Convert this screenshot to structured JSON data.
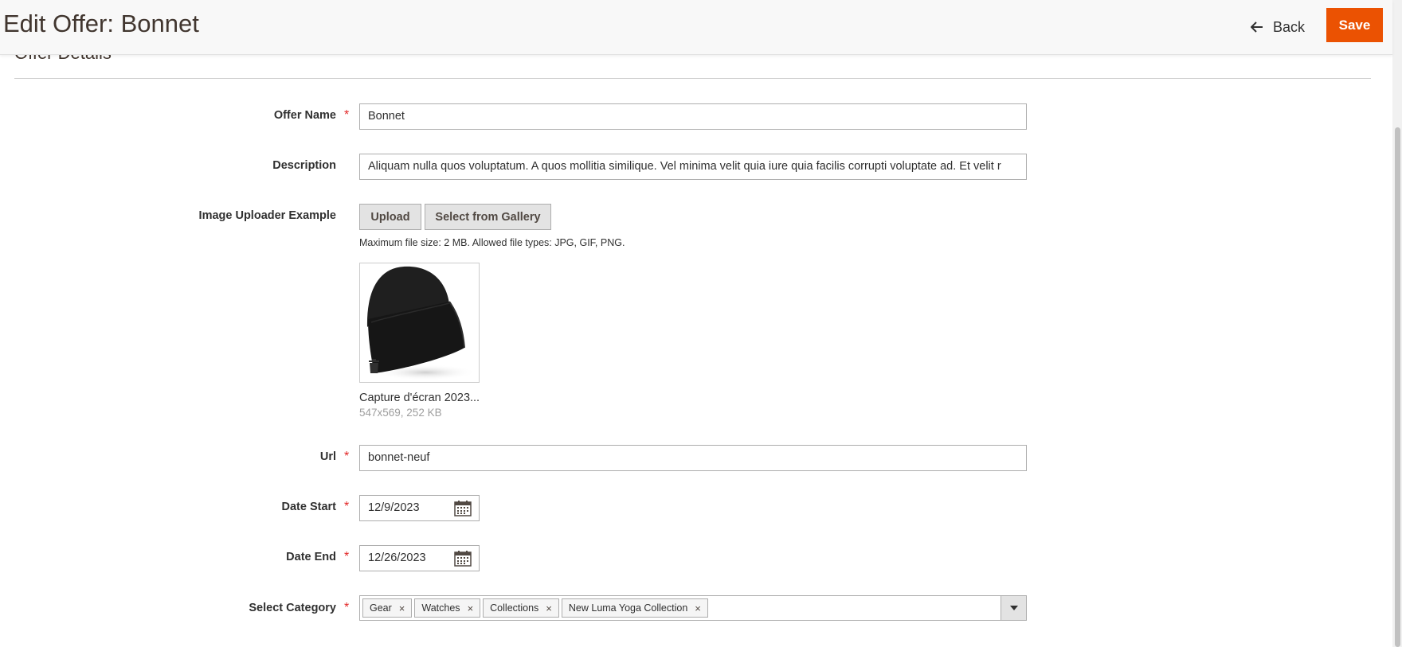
{
  "header": {
    "title": "Edit Offer: Bonnet",
    "back_label": "Back",
    "save_label": "Save"
  },
  "fieldset": {
    "title": "Offer Details"
  },
  "form": {
    "offer_name": {
      "label": "Offer Name",
      "required": true,
      "value": "Bonnet"
    },
    "description": {
      "label": "Description",
      "value": "Aliquam nulla quos voluptatum. A quos mollitia similique. Vel minima velit quia iure quia facilis corrupti voluptate ad. Et velit r"
    },
    "image": {
      "label": "Image Uploader Example",
      "upload_label": "Upload",
      "gallery_label": "Select from Gallery",
      "note": "Maximum file size: 2 MB. Allowed file types: JPG, GIF, PNG.",
      "file_name": "Capture d'écran 2023...",
      "file_meta": "547x569, 252 KB"
    },
    "url": {
      "label": "Url",
      "required": true,
      "value": "bonnet-neuf"
    },
    "date_start": {
      "label": "Date Start",
      "required": true,
      "value": "12/9/2023"
    },
    "date_end": {
      "label": "Date End",
      "required": true,
      "value": "12/26/2023"
    },
    "category": {
      "label": "Select Category",
      "required": true,
      "tags": [
        "Gear",
        "Watches",
        "Collections",
        "New Luma Yoga Collection"
      ]
    }
  },
  "required_mark": "*",
  "remove_glyph": "×",
  "colors": {
    "accent": "#eb5202",
    "required": "#e22626"
  }
}
